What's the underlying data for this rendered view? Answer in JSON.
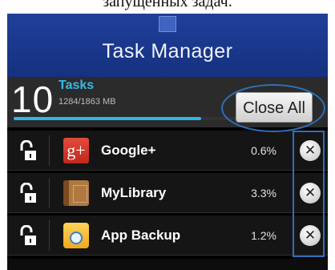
{
  "caption": "запущенных задач.",
  "header": {
    "title": "Task Manager",
    "logo_icon": "chart-icon"
  },
  "summary": {
    "count": "10",
    "label": "Tasks",
    "memory": "1284/1863 MB",
    "memory_used_fraction": 0.689,
    "close_all_label": "Close All"
  },
  "apps": [
    {
      "name": "Google+",
      "usage": "0.6%",
      "icon": "google-plus-icon",
      "icon_glyph": "g+",
      "lock_icon": "unlocked-padlock-icon",
      "kill_icon": "close-icon",
      "kill_glyph": "✕"
    },
    {
      "name": "MyLibrary",
      "usage": "3.3%",
      "icon": "book-icon",
      "lock_icon": "unlocked-padlock-icon",
      "kill_icon": "close-icon",
      "kill_glyph": "✕"
    },
    {
      "name": "App Backup",
      "usage": "1.2%",
      "icon": "folder-backup-icon",
      "lock_icon": "unlocked-padlock-icon",
      "kill_icon": "close-icon",
      "kill_glyph": "✕"
    }
  ],
  "annotations": {
    "highlight_color": "#2f6fb8"
  }
}
